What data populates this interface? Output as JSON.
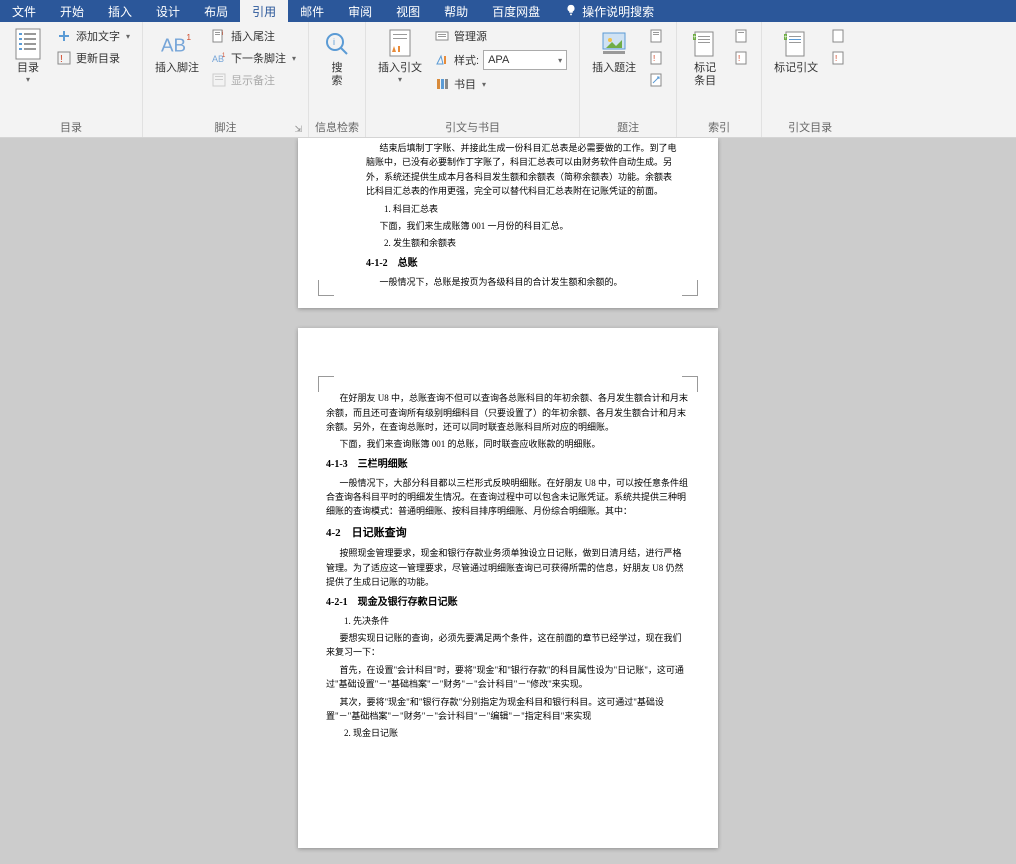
{
  "tabs": {
    "file": "文件",
    "start": "开始",
    "insert": "插入",
    "design": "设计",
    "layout": "布局",
    "references": "引用",
    "mail": "邮件",
    "review": "审阅",
    "view": "视图",
    "help": "帮助",
    "baidudisk": "百度网盘",
    "tellme": "操作说明搜索"
  },
  "ribbon": {
    "toc": {
      "main": "目录",
      "addText": "添加文字",
      "updateToc": "更新目录",
      "groupLabel": "目录"
    },
    "footnotes": {
      "insertFootnote": "插入脚注",
      "insertEndnote": "插入尾注",
      "nextFootnote": "下一条脚注",
      "showNotes": "显示备注",
      "groupLabel": "脚注"
    },
    "research": {
      "search": "搜\n索",
      "groupLabel": "信息检索"
    },
    "citations": {
      "insertCitation": "插入引文",
      "manageSources": "管理源",
      "styleLabel": "样式:",
      "styleValue": "APA",
      "bibliography": "书目",
      "groupLabel": "引文与书目"
    },
    "captions": {
      "insertCaption": "插入题注",
      "groupLabel": "题注"
    },
    "index": {
      "markEntry": "标记\n条目",
      "groupLabel": "索引"
    },
    "authorities": {
      "markCitation": "标记引文",
      "groupLabel": "引文目录"
    }
  },
  "document": {
    "page1": {
      "p1": "结束后填制丁字账、并接此生成一份科目汇总表是必需要做的工作。到了电脑账中，已没有必要制作丁字账了，科目汇总表可以由财务软件自动生成。另外，系统还提供生成本月各科目发生额和余额表（简称余额表）功能。余额表比科目汇总表的作用更强，完全可以替代科目汇总表附在记账凭证的前面。",
      "n1": "1. 科目汇总表",
      "p2": "下面，我们来生成账簿 001 一月份的科目汇总。",
      "n2": "2. 发生额和余额表",
      "h1": "4-1-2　总账",
      "p3": "一般情况下，总账是按页为各级科目的合计发生额和余额的。"
    },
    "page2": {
      "p1": "在好朋友 U8 中，总账查询不但可以查询各总账科目的年初余额、各月发生额合计和月末余额，而且还可查询所有级别明细科目（只要设置了）的年初余额、各月发生额合计和月末余额。另外，在查询总账时，还可以同时联查总账科目所对应的明细账。",
      "p2": "下面，我们来查询账簿 001 的总账，同时联查应收账款的明细账。",
      "h1": "4-1-3　三栏明细账",
      "p3": "一般情况下，大部分科目都以三栏形式反映明细账。在好朋友 U8 中，可以按任意条件组合查询各科目平时的明细发生情况。在查询过程中可以包含未记账凭证。系统共提供三种明细账的查询模式：普通明细账、按科目排序明细账、月份综合明细账。其中：",
      "h2": "4-2　日记账查询",
      "p4": "按照现金管理要求，现金和银行存款业务须单独设立日记账，做到日清月结，进行严格管理。为了适应这一管理要求，尽管通过明细账查询已可获得所需的信息，好朋友 U8 仍然提供了生成日记账的功能。",
      "h3": "4-2-1　现金及银行存款日记账",
      "n1": "1. 先决条件",
      "p5": "要想实现日记账的查询，必须先要满足两个条件，这在前面的章节已经学过，现在我们来复习一下：",
      "p6": "首先，在设置\"会计科目\"时，要将\"现金\"和\"银行存款\"的科目属性设为\"日记账\"，这可通过\"基础设置\"－\"基础档案\"－\"财务\"－\"会计科目\"－\"修改\"来实现。",
      "p7": "其次，要将\"现金\"和\"银行存款\"分别指定为现金科目和银行科目。这可通过\"基础设置\"－\"基础档案\"－\"财务\"－\"会计科目\"－\"编辑\"－\"指定科目\"来实现",
      "n2": "2. 现金日记账"
    }
  }
}
